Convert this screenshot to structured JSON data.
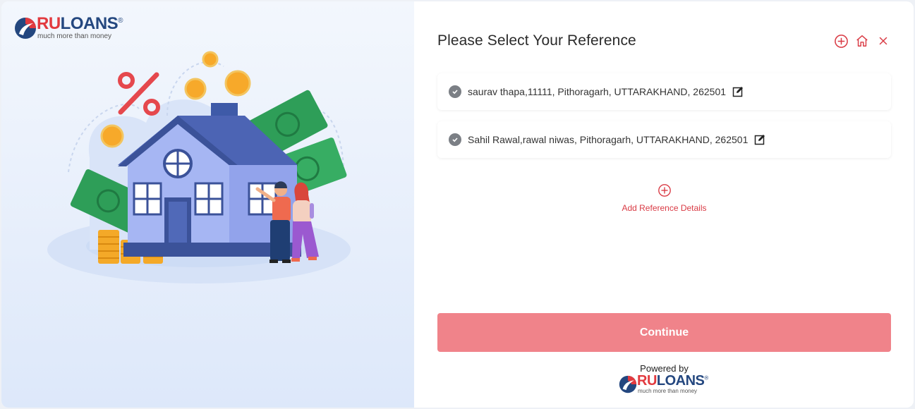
{
  "brand": {
    "name_part1": "RU",
    "name_part2": "LOANS",
    "registered": "®",
    "tagline": "much more than money",
    "colors": {
      "red": "#e23a3f",
      "navy": "#24477f"
    }
  },
  "header": {
    "title": "Please Select Your Reference",
    "actions": [
      {
        "name": "add-icon"
      },
      {
        "name": "home-icon"
      },
      {
        "name": "close-icon"
      }
    ]
  },
  "references": [
    {
      "text": "saurav thapa,11111, Pithoragarh, UTTARAKHAND, 262501",
      "selected": true
    },
    {
      "text": "Sahil Rawal,rawal niwas, Pithoragarh, UTTARAKHAND, 262501",
      "selected": true
    }
  ],
  "add_reference": {
    "label": "Add Reference Details",
    "icon": "plus-circle-icon"
  },
  "continue_button": {
    "label": "Continue",
    "color": "#f0838a"
  },
  "footer": {
    "powered_by": "Powered by"
  },
  "colors": {
    "accent": "#d93a44"
  }
}
